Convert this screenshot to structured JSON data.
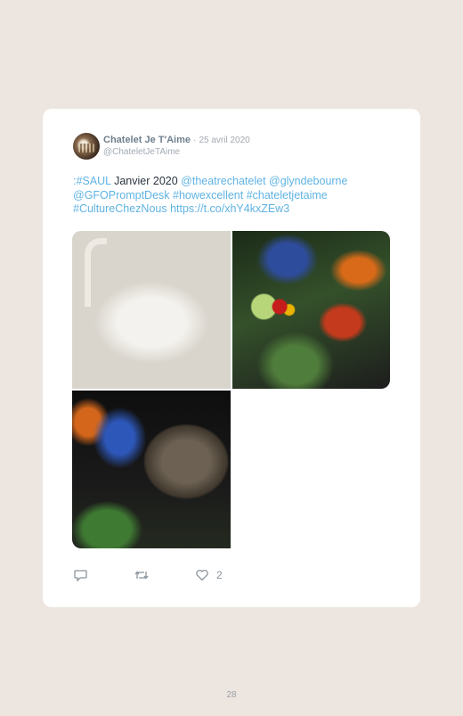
{
  "tweet": {
    "author_name": "Chatelet Je T'Aime",
    "separator": "·",
    "date": "25 avril 2020",
    "handle": "@ChateletJeTAime",
    "text_segments": [
      {
        "text": ":#SAUL",
        "link": true
      },
      {
        "text": " Janvier 2020 ",
        "link": false
      },
      {
        "text": "@theatrechatelet @glyndebourne @GFOPromptDesk #howexcellent #chateletjetaime #CultureChezNous https://t.co/xhY4kxZEw3",
        "link": true
      }
    ],
    "photos": [
      {
        "subject": "swan"
      },
      {
        "subject": "lobster-fruit-flowers"
      },
      {
        "subject": "boar"
      }
    ],
    "like_count": "2"
  },
  "icons": {
    "reply": "reply-icon",
    "retweet": "retweet-icon",
    "like": "heart-icon"
  },
  "colors": {
    "background": "#ede5e0",
    "card": "#ffffff",
    "link": "#5fb3e3",
    "icon": "#8b949c"
  },
  "page_number": "28"
}
